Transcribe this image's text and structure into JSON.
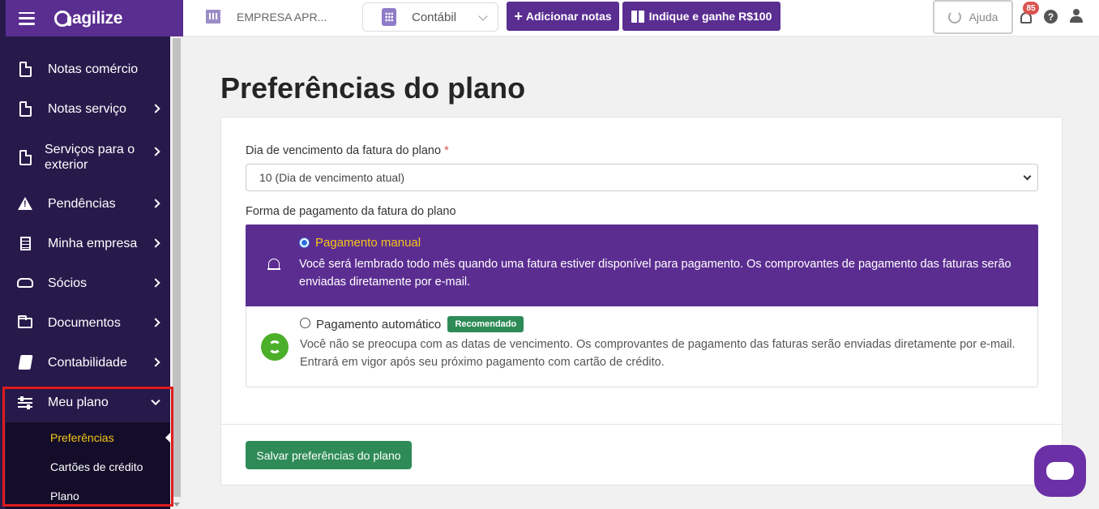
{
  "brand": {
    "name": "agilize"
  },
  "topbar": {
    "company": "EMPRESA APR...",
    "module": "Contábil",
    "add_notes": "Adicionar notas",
    "refer": "Indique e ganhe R$100",
    "help": "Ajuda",
    "notifications_count": "85"
  },
  "sidebar": {
    "items": [
      {
        "label": "Notas comércio",
        "icon": "document-icon"
      },
      {
        "label": "Notas serviço",
        "icon": "document-icon"
      },
      {
        "label": "Serviços para o exterior",
        "icon": "document-icon"
      },
      {
        "label": "Pendências",
        "icon": "warning-icon"
      },
      {
        "label": "Minha empresa",
        "icon": "building-icon"
      },
      {
        "label": "Sócios",
        "icon": "handshake-icon"
      },
      {
        "label": "Documentos",
        "icon": "folder-open-icon"
      },
      {
        "label": "Contabilidade",
        "icon": "book-icon"
      },
      {
        "label": "Meu plano",
        "icon": "sliders-icon"
      }
    ],
    "submenu": [
      "Preferências",
      "Cartões de crédito",
      "Plano"
    ]
  },
  "main": {
    "title": "Preferências do plano",
    "due_day_label": "Dia de vencimento da fatura do plano",
    "due_day_required": "*",
    "due_day_value": "10 (Dia de vencimento atual)",
    "payment_label": "Forma de pagamento da fatura do plano",
    "manual": {
      "title": "Pagamento manual",
      "desc": "Você será lembrado todo mês quando uma fatura estiver disponível para pagamento. Os comprovantes de pagamento das faturas serão enviadas diretamente por e-mail."
    },
    "auto": {
      "title": "Pagamento automático",
      "badge": "Recomendado",
      "desc": "Você não se preocupa com as datas de vencimento. Os comprovantes de pagamento das faturas serão enviadas diretamente por e-mail. Entrará em vigor após seu próximo pagamento com cartão de crédito."
    },
    "save": "Salvar preferências do plano"
  },
  "colors": {
    "brand_purple": "#5a2d91",
    "sidebar_bg": "#271a4b",
    "accent_yellow": "#f5c518",
    "success_green": "#2e8b57",
    "highlight_red": "#e01b1b"
  }
}
